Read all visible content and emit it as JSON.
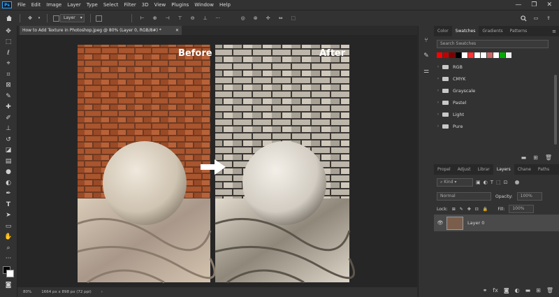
{
  "menu": {
    "logo": "Ps",
    "items": [
      "File",
      "Edit",
      "Image",
      "Layer",
      "Type",
      "Select",
      "Filter",
      "3D",
      "View",
      "Plugins",
      "Window",
      "Help"
    ],
    "window_controls": [
      "—",
      "❐",
      "✕"
    ]
  },
  "options_bar": {
    "layer_dropdown": "Layer"
  },
  "document": {
    "tab_title": "How to Add Texture in Photoshop.jpeg @ 80% (Layer 0, RGB/8#) *",
    "before_label": "Before",
    "after_label": "After"
  },
  "status": {
    "zoom": "80%",
    "dimensions": "1664 px x 898 px (72 ppi)"
  },
  "swatches_panel": {
    "tabs": [
      "Color",
      "Swatches",
      "Gradients",
      "Patterns"
    ],
    "active_tab": "Swatches",
    "search_placeholder": "Search Swatches",
    "colors": [
      "#ff0000",
      "#c00000",
      "#800000",
      "#000000",
      "#ffffff",
      "#ff3333",
      "#ffffff",
      "#ffffff",
      "#cc6666",
      "#ffffff",
      "#00aa00",
      "#eeeeee"
    ],
    "folders": [
      "RGB",
      "CMYK",
      "Grayscale",
      "Pastel",
      "Light",
      "Pure"
    ]
  },
  "layers_panel": {
    "tabs": [
      "Propel",
      "Adjust",
      "Librar",
      "Layers",
      "Chane",
      "Paths"
    ],
    "active_tab": "Layers",
    "kind_filter": "Kind",
    "blend_mode": "Normal",
    "opacity_label": "Opacity:",
    "opacity_value": "100%",
    "lock_label": "Lock:",
    "fill_label": "Fill:",
    "fill_value": "100%",
    "layer_name": "Layer 0"
  }
}
